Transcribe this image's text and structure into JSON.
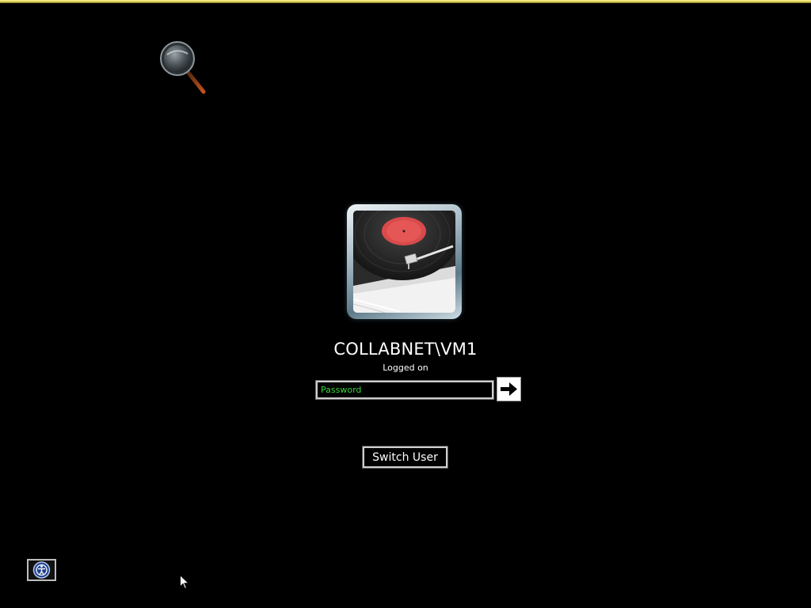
{
  "login": {
    "username": "COLLABNET\\VM1",
    "status": "Logged on",
    "password_placeholder": "Password",
    "switch_user_label": "Switch User"
  },
  "icons": {
    "magnifier": "magnifier-icon",
    "user_tile": "vinyl-record-player",
    "submit": "arrow-right-icon",
    "ease_of_access": "ease-of-access-icon",
    "cursor": "mouse-cursor"
  },
  "colors": {
    "background": "#000000",
    "text": "#ffffff",
    "placeholder": "#3ad43a",
    "top_strip": "#d8c84a"
  }
}
